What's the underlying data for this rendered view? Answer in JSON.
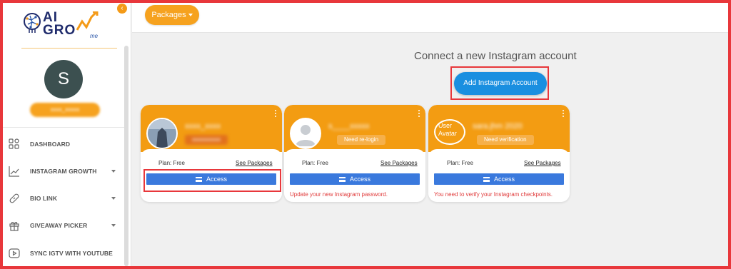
{
  "sidebar": {
    "logo": {
      "line1": "AI",
      "line2": "GRO",
      "suffix": "me"
    },
    "collapse_icon": "chevron-left-icon",
    "avatar_initial": "S",
    "username": "xxxx_xxxxx",
    "nav_items": [
      {
        "label": "DASHBOARD",
        "icon": "grid-icon",
        "has_caret": false
      },
      {
        "label": "INSTAGRAM GROWTH",
        "icon": "trend-icon",
        "has_caret": true
      },
      {
        "label": "BIO LINK",
        "icon": "link-icon",
        "has_caret": true
      },
      {
        "label": "GIVEAWAY PICKER",
        "icon": "gift-icon",
        "has_caret": true
      },
      {
        "label": "SYNC IGTV WITH YOUTUBE",
        "icon": "play-icon",
        "has_caret": false
      }
    ]
  },
  "topbar": {
    "packages_label": "Packages"
  },
  "main": {
    "connect_title": "Connect a new Instagram account",
    "add_button_label": "Add Instagram Account"
  },
  "cards": [
    {
      "name": "xxxx_xxxx",
      "badge": "xxxxxxxxxx",
      "plan": "Plan: Free",
      "see_packages": "See Packages",
      "access_label": "Access",
      "warning": ""
    },
    {
      "name": "s____xxxxx",
      "badge": "Need re-login",
      "plan": "Plan: Free",
      "see_packages": "See Packages",
      "access_label": "Access",
      "warning": "Update your new Instagram password."
    },
    {
      "name": "sara.jhm 2020",
      "avatar_alt": "User Avatar",
      "badge": "Need verification",
      "plan": "Plan: Free",
      "see_packages": "See Packages",
      "access_label": "Access",
      "warning": "You need to verify your Instagram checkpoints."
    }
  ],
  "colors": {
    "accent": "#f39c12",
    "primary_blue": "#1a8fe0",
    "access_blue": "#3a79dd",
    "highlight_red": "#e8373b",
    "warning_red": "#e03a3a"
  }
}
